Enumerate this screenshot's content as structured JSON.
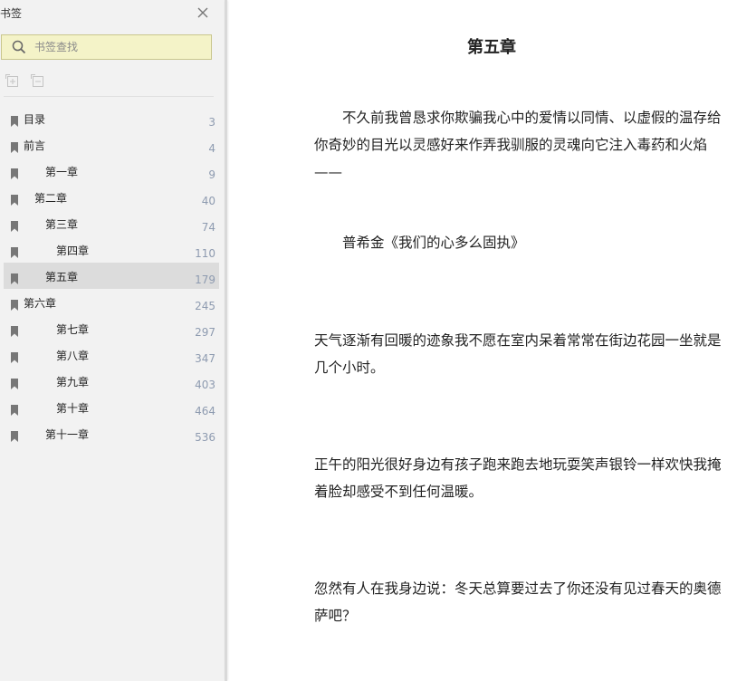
{
  "sidebar": {
    "title": "书签",
    "search_placeholder": "书签查找",
    "items": [
      {
        "label": "目录",
        "page": "3"
      },
      {
        "label": "前言",
        "page": "4"
      },
      {
        "label": "第一章",
        "page": "9"
      },
      {
        "label": "第二章",
        "page": "40"
      },
      {
        "label": "第三章",
        "page": "74"
      },
      {
        "label": "第四章",
        "page": "110"
      },
      {
        "label": "第五章",
        "page": "179"
      },
      {
        "label": "第六章",
        "page": "245"
      },
      {
        "label": "第七章",
        "page": "297"
      },
      {
        "label": "第八章",
        "page": "347"
      },
      {
        "label": "第九章",
        "page": "403"
      },
      {
        "label": "第十章",
        "page": "464"
      },
      {
        "label": "第十一章",
        "page": "536"
      }
    ]
  },
  "content": {
    "chapter_title": "第五章",
    "paragraphs": [
      "　　不久前我曾恳求你欺骗我心中的爱情以同情、以虚假的温存给你奇妙的目光以灵感好来作弄我驯服的灵魂向它注入毒药和火焰——",
      "　　普希金《我们的心多么固执》",
      "天气逐渐有回暖的迹象我不愿在室内呆着常常在街边花园一坐就是几个小时。",
      "正午的阳光很好身边有孩子跑来跑去地玩耍笑声银铃一样欢快我掩着脸却感受不到任何温暖。",
      "忽然有人在我身边说：冬天总算要过去了你还没有见过春天的奥德萨吧？"
    ]
  },
  "colors": {
    "sidebar_bg": "#f2f2f2",
    "search_bg": "#f4f3c8",
    "selected_bg": "#dcdcdc",
    "page_number": "#8e9bb0"
  }
}
